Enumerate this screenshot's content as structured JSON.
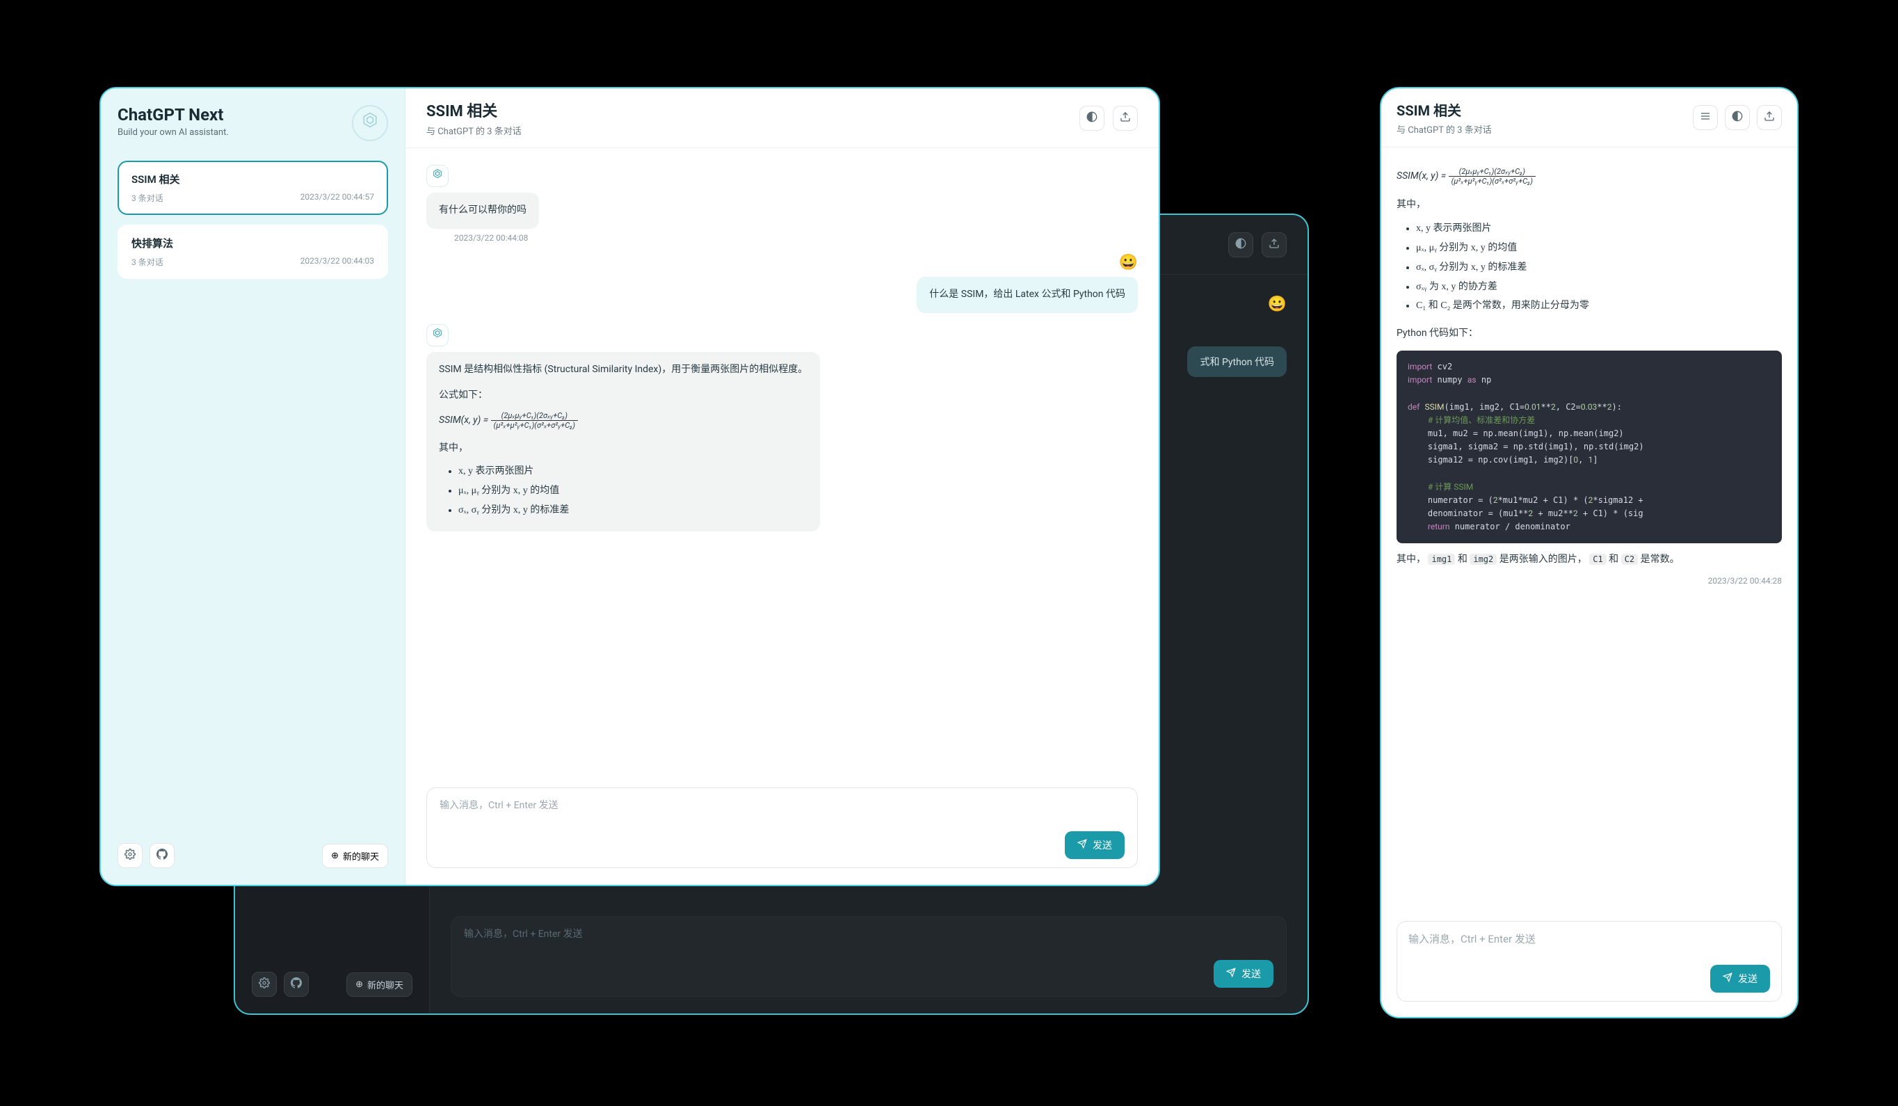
{
  "brand": {
    "title": "ChatGPT Next",
    "subtitle": "Build your own AI assistant."
  },
  "sidebar": {
    "items": [
      {
        "title": "SSIM 相关",
        "count": "3 条对话",
        "time": "2023/3/22 00:44:57",
        "active": true
      },
      {
        "title": "快排算法",
        "count": "3 条对话",
        "time": "2023/3/22 00:44:03",
        "active": false
      }
    ],
    "new_chat": "新的聊天"
  },
  "topbar": {
    "title": "SSIM 相关",
    "subtitle": "与 ChatGPT 的 3 条对话"
  },
  "chat": {
    "greet": "有什么可以帮你的吗",
    "greet_time": "2023/3/22 00:44:08",
    "user_q": "什么是 SSIM，给出 Latex 公式和 Python 代码",
    "ssim_intro": "SSIM 是结构相似性指标 (Structural Similarity Index)，用于衡量两张图片的相似程度。",
    "formula_label": "公式如下：",
    "formula_lhs": "SSIM(x, y) = ",
    "formula_num": "(2μₓμᵧ+C₁)(2σₓᵧ+C₂)",
    "formula_den": "(μ²ₓ+μ²ᵧ+C₁)(σ²ₓ+σ²ᵧ+C₂)",
    "where": "其中，",
    "defs": [
      "x, y 表示两张图片",
      "μₓ, μᵧ 分别为 x, y 的均值",
      "σₓ, σᵧ 分别为 x, y 的标准差"
    ]
  },
  "composer": {
    "placeholder": "输入消息，Ctrl + Enter 发送",
    "send": "发送"
  },
  "dark": {
    "user_q": "式和 Python 代码",
    "new_chat": "新的聊天",
    "placeholder": "输入消息，Ctrl + Enter 发送",
    "send": "发送"
  },
  "mobile": {
    "title": "SSIM 相关",
    "subtitle": "与 ChatGPT 的 3 条对话",
    "formula_lhs": "SSIM(x, y) = ",
    "formula_num": "(2μₓμᵧ+C₁)(2σₓᵧ+C₂)",
    "formula_den": "(μ²ₓ+μ²ᵧ+C₁)(σ²ₓ+σ²ᵧ+C₂)",
    "where": "其中，",
    "defs": [
      "x, y 表示两张图片",
      "μₓ, μᵧ 分别为 x, y 的均值",
      "σₓ, σᵧ 分别为 x, y 的标准差",
      "σₓᵧ 为 x, y 的协方差",
      "C₁ 和 C₂ 是两个常数，用来防止分母为零"
    ],
    "python_label": "Python 代码如下：",
    "footer_text_1": "其中，",
    "footer_code_1": "img1",
    "footer_text_2": " 和 ",
    "footer_code_2": "img2",
    "footer_text_3": " 是两张输入的图片，",
    "footer_code_3": "C1",
    "footer_text_4": " 和 ",
    "footer_code_4": "C2",
    "footer_text_5": " 是常数。",
    "timestamp": "2023/3/22 00:44:28",
    "placeholder": "输入消息，Ctrl + Enter 发送",
    "send": "发送"
  }
}
